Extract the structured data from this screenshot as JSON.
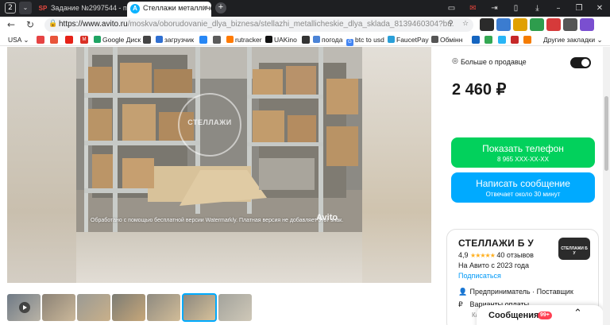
{
  "browser": {
    "tab_count": "2",
    "tabs": [
      {
        "label": "Задание №2997544 - про",
        "favicon": "SP"
      },
      {
        "label": "Стеллажи металличес",
        "favicon": "A"
      }
    ],
    "url_host": "https://www.avito.ru",
    "url_path": "/moskva/oborudovanie_dlya_biznesa/stellazhi_metallicheskie_dlya_sklada_8139460304?bu...",
    "bookmarks": [
      "USA",
      "Google Диск",
      "загрузчик",
      "rutracker",
      "UAKino",
      "погода",
      "btc to usd",
      "FaucetPay",
      "Обмінн"
    ],
    "other_bookmarks": "Другие закладки"
  },
  "listing": {
    "watermark_note": "Обработано с помощью бесплатной версии Watermarkly. Платная версия не добавляет этот знак.",
    "watermark_avito": "Avito",
    "photo_logo_text": "СТЕЛЛАЖИ",
    "thumbnail_count": 7,
    "active_thumbnail": 6
  },
  "sidebar": {
    "more_from_seller": "Больше о продавце",
    "price": "2 460 ₽",
    "phone_button": "Показать телефон",
    "phone_number": "8 965 XXX-XX-XX",
    "message_button": "Написать сообщение",
    "message_sub": "Отвечает около 30 минут"
  },
  "seller": {
    "name": "СТЕЛЛАЖИ Б У",
    "rating": "4,9",
    "stars": "★★★★★",
    "reviews": "40 отзывов",
    "since": "На Авито с 2023 года",
    "subscribe": "Подписаться",
    "type": "Предприниматель · Поставщик",
    "payment": "Варианты оплаты",
    "payment_sub": "Кар"
  },
  "messages": {
    "label": "Сообщения",
    "badge": "99+"
  },
  "colors": {
    "green": "#02d15c",
    "blue": "#00aaff",
    "link": "#0099f7",
    "star": "#ffb021"
  }
}
